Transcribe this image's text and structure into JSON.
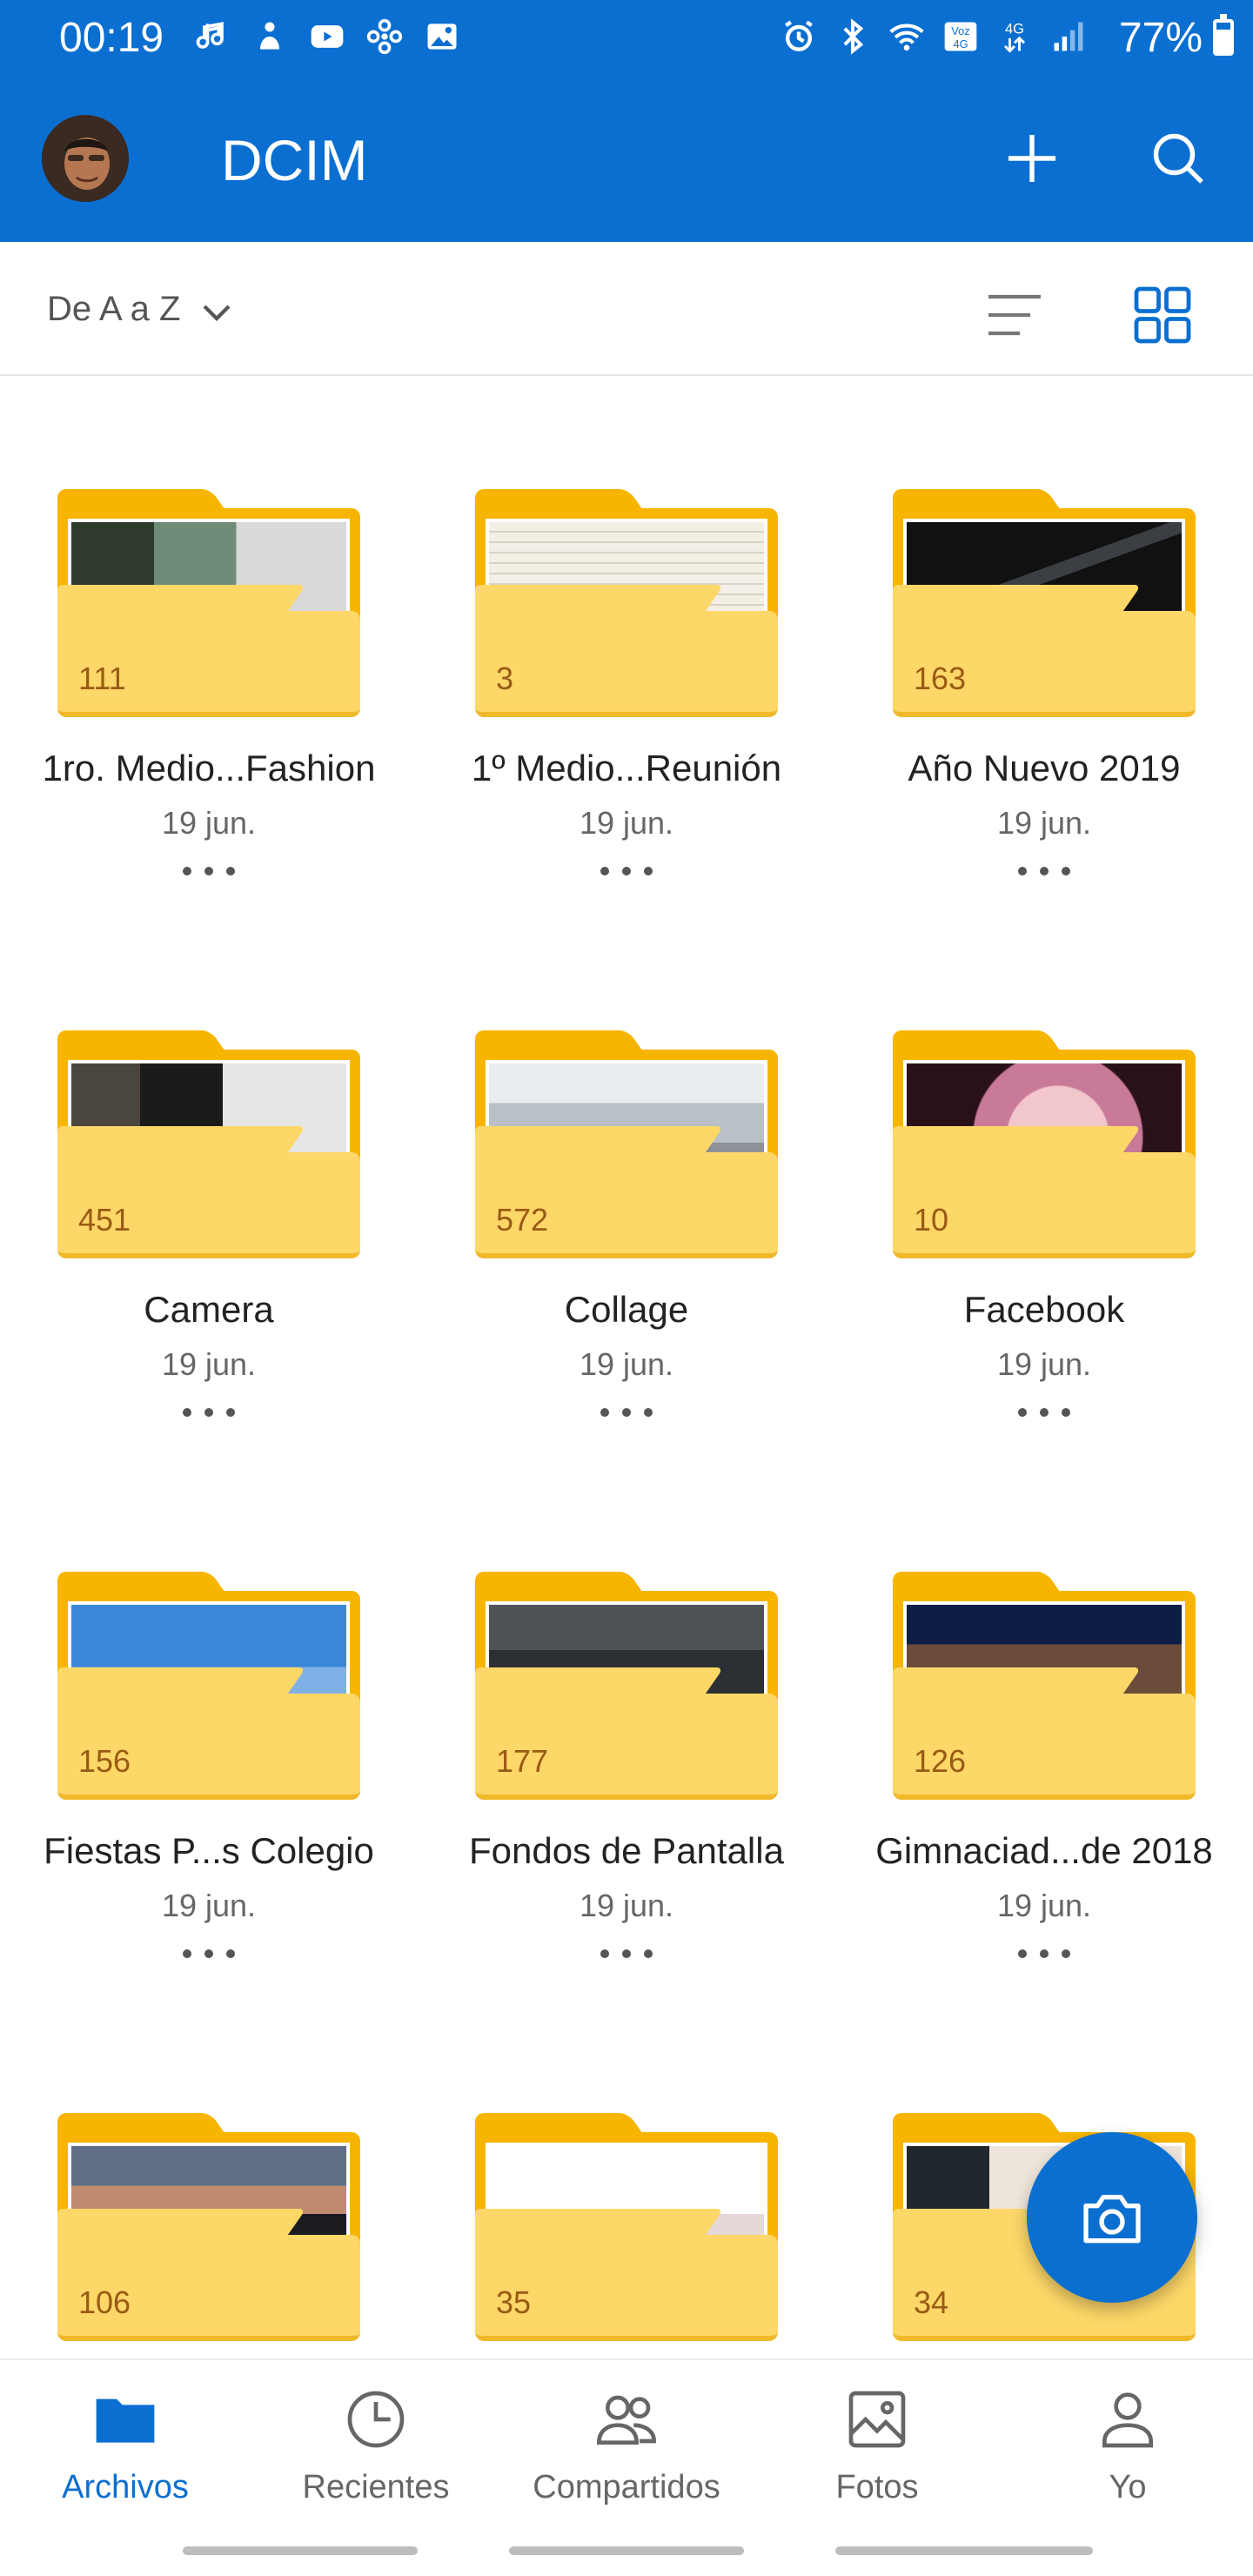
{
  "status_bar": {
    "time": "00:19",
    "left_icons": [
      "music-note-icon",
      "notification-icon",
      "youtube-icon",
      "fan-icon",
      "image-icon"
    ],
    "right_icons": [
      "alarm-icon",
      "bluetooth-icon",
      "wifi-icon",
      "volte-icon",
      "data-4g-icon",
      "signal-icon"
    ],
    "battery_percent": "77%",
    "battery_level": 0.77
  },
  "app_bar": {
    "title": "DCIM",
    "add_icon": "plus-icon",
    "search_icon": "search-icon"
  },
  "sort_bar": {
    "sort_label": "De A a Z",
    "list_view_icon": "list-view-icon",
    "grid_view_icon": "grid-view-icon"
  },
  "folders": [
    {
      "count": "111",
      "name": "1ro. Medio...Fashion",
      "date": "19 jun."
    },
    {
      "count": "3",
      "name": "1º Medio...Reunión",
      "date": "19 jun."
    },
    {
      "count": "163",
      "name": "Año Nuevo 2019",
      "date": "19 jun."
    },
    {
      "count": "451",
      "name": "Camera",
      "date": "19 jun."
    },
    {
      "count": "572",
      "name": "Collage",
      "date": "19 jun."
    },
    {
      "count": "10",
      "name": "Facebook",
      "date": "19 jun."
    },
    {
      "count": "156",
      "name": "Fiestas P...s Colegio",
      "date": "19 jun."
    },
    {
      "count": "177",
      "name": "Fondos de Pantalla",
      "date": "19 jun."
    },
    {
      "count": "126",
      "name": "Gimnaciad...de 2018",
      "date": "19 jun."
    },
    {
      "count": "106",
      "name": "",
      "date": ""
    },
    {
      "count": "35",
      "name": "",
      "date": ""
    },
    {
      "count": "34",
      "name": "",
      "date": ""
    }
  ],
  "fab": {
    "icon": "camera-icon"
  },
  "bottom_nav": [
    {
      "label": "Archivos",
      "icon": "folder-icon",
      "active": true
    },
    {
      "label": "Recientes",
      "icon": "clock-icon",
      "active": false
    },
    {
      "label": "Compartidos",
      "icon": "people-icon",
      "active": false
    },
    {
      "label": "Fotos",
      "icon": "photo-icon",
      "active": false
    },
    {
      "label": "Yo",
      "icon": "person-icon",
      "active": false
    }
  ],
  "colors": {
    "brand_blue": "#0a6fd1",
    "folder_yellow": "#f7b500",
    "folder_front": "#fdd768",
    "count_text": "#9a5a14"
  }
}
